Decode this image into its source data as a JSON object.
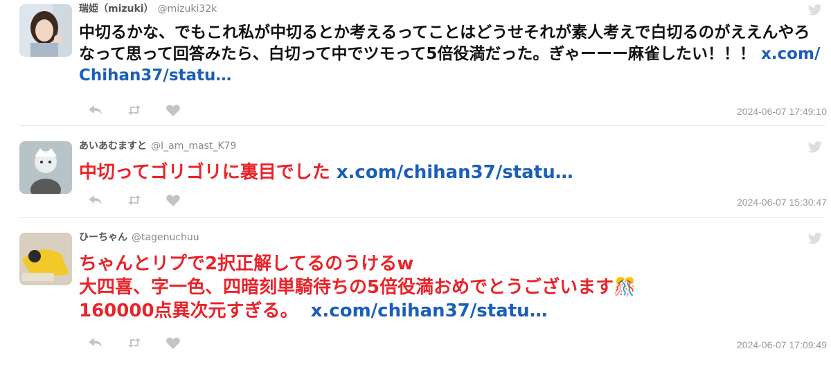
{
  "tweets": [
    {
      "name": "瑞姫（mizuki）",
      "handle": "@mizuki32k",
      "text": "中切るかな、でもこれ私が中切るとか考えるってことはどうせそれが素人考えで白切るのがええんやろなって思って回答みたら、白切って中でツモって5倍役満だった。ぎゃーーー麻雀したい！！！",
      "link": "x.com/Chihan37/statu…",
      "timestamp": "2024-06-07 17:49:10",
      "text_color": "#111111",
      "avatar_colors": [
        "#dde6ec",
        "#3c2a22",
        "#f2d6c4"
      ]
    },
    {
      "name": "あいあむますと",
      "handle": "@I_am_mast_K79",
      "text": "中切ってゴリゴリに裏目でした",
      "link": "x.com/chihan37/statu…",
      "timestamp": "2024-06-07 15:30:47",
      "text_color": "#e8242a",
      "avatar_colors": [
        "#b8c3c7",
        "#ffffff",
        "#595959"
      ]
    },
    {
      "name": "ひーちゃん",
      "handle": "@tagenuchuu",
      "lines": [
        "ちゃんとリプで2択正解してるのうけるw",
        "大四喜、字一色、四暗刻単騎待ちの5倍役満おめでとうございます🎊"
      ],
      "last_line": "160000点異次元すぎる。",
      "link": "x.com/chihan37/statu…",
      "timestamp": "2024-06-07 17:09:49",
      "text_color": "#e8242a",
      "avatar_colors": [
        "#d9cfc0",
        "#f3c92a",
        "#2a2a2a"
      ]
    }
  ],
  "icons": {
    "reply": "reply-icon",
    "retweet": "retweet-icon",
    "like": "heart-icon",
    "bird": "twitter-bird-icon"
  }
}
